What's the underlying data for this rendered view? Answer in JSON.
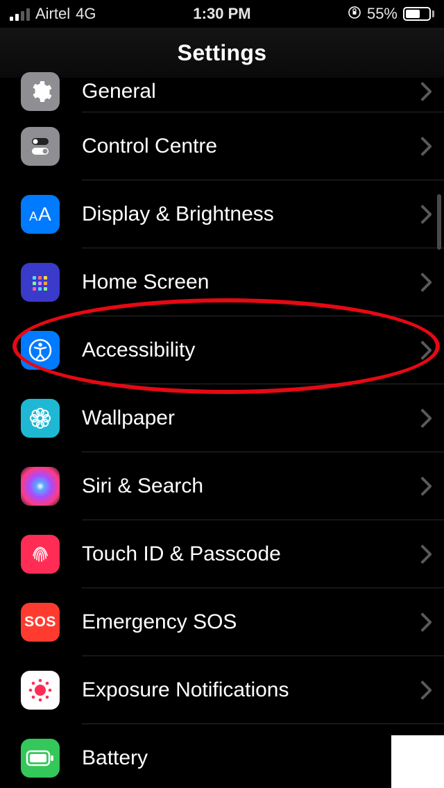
{
  "status": {
    "carrier": "Airtel",
    "network": "4G",
    "time": "1:30 PM",
    "battery_pct": "55%"
  },
  "header": {
    "title": "Settings"
  },
  "items": [
    {
      "label": "General"
    },
    {
      "label": "Control Centre"
    },
    {
      "label": "Display & Brightness"
    },
    {
      "label": "Home Screen"
    },
    {
      "label": "Accessibility"
    },
    {
      "label": "Wallpaper"
    },
    {
      "label": "Siri & Search"
    },
    {
      "label": "Touch ID & Passcode"
    },
    {
      "label": "Emergency SOS"
    },
    {
      "label": "Exposure Notifications"
    },
    {
      "label": "Battery"
    }
  ],
  "icons": {
    "sos_text": "SOS"
  }
}
